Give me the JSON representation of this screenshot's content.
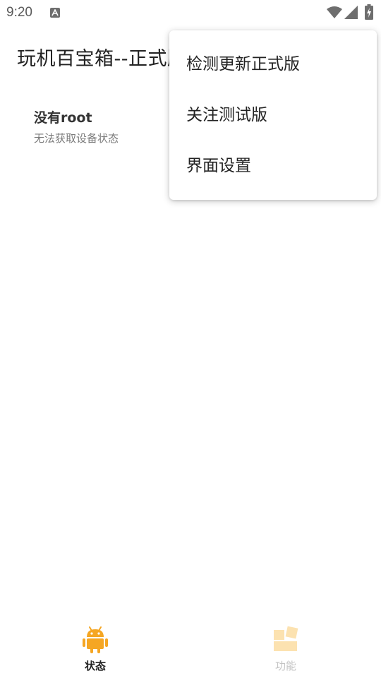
{
  "status_bar": {
    "time": "9:20",
    "notification_icon": "a-letter-icon",
    "wifi_icon": "wifi-icon",
    "signal_icon": "signal-icon",
    "battery_icon": "battery-charging-icon"
  },
  "app_bar": {
    "title": "玩机百宝箱--正式版"
  },
  "root_status": {
    "title": "没有root",
    "subtitle": "无法获取设备状态"
  },
  "overflow_menu": {
    "items": [
      {
        "label": "检测更新正式版"
      },
      {
        "label": "关注测试版"
      },
      {
        "label": "界面设置"
      }
    ]
  },
  "bottom_nav": {
    "tabs": [
      {
        "label": "状态",
        "icon": "android-icon",
        "selected": true
      },
      {
        "label": "功能",
        "icon": "function-icon",
        "selected": false
      }
    ]
  },
  "colors": {
    "accent": "#F5A623",
    "accent_light": "#FCE2B0",
    "text_primary": "#222222",
    "text_secondary": "#7A7A7A"
  }
}
